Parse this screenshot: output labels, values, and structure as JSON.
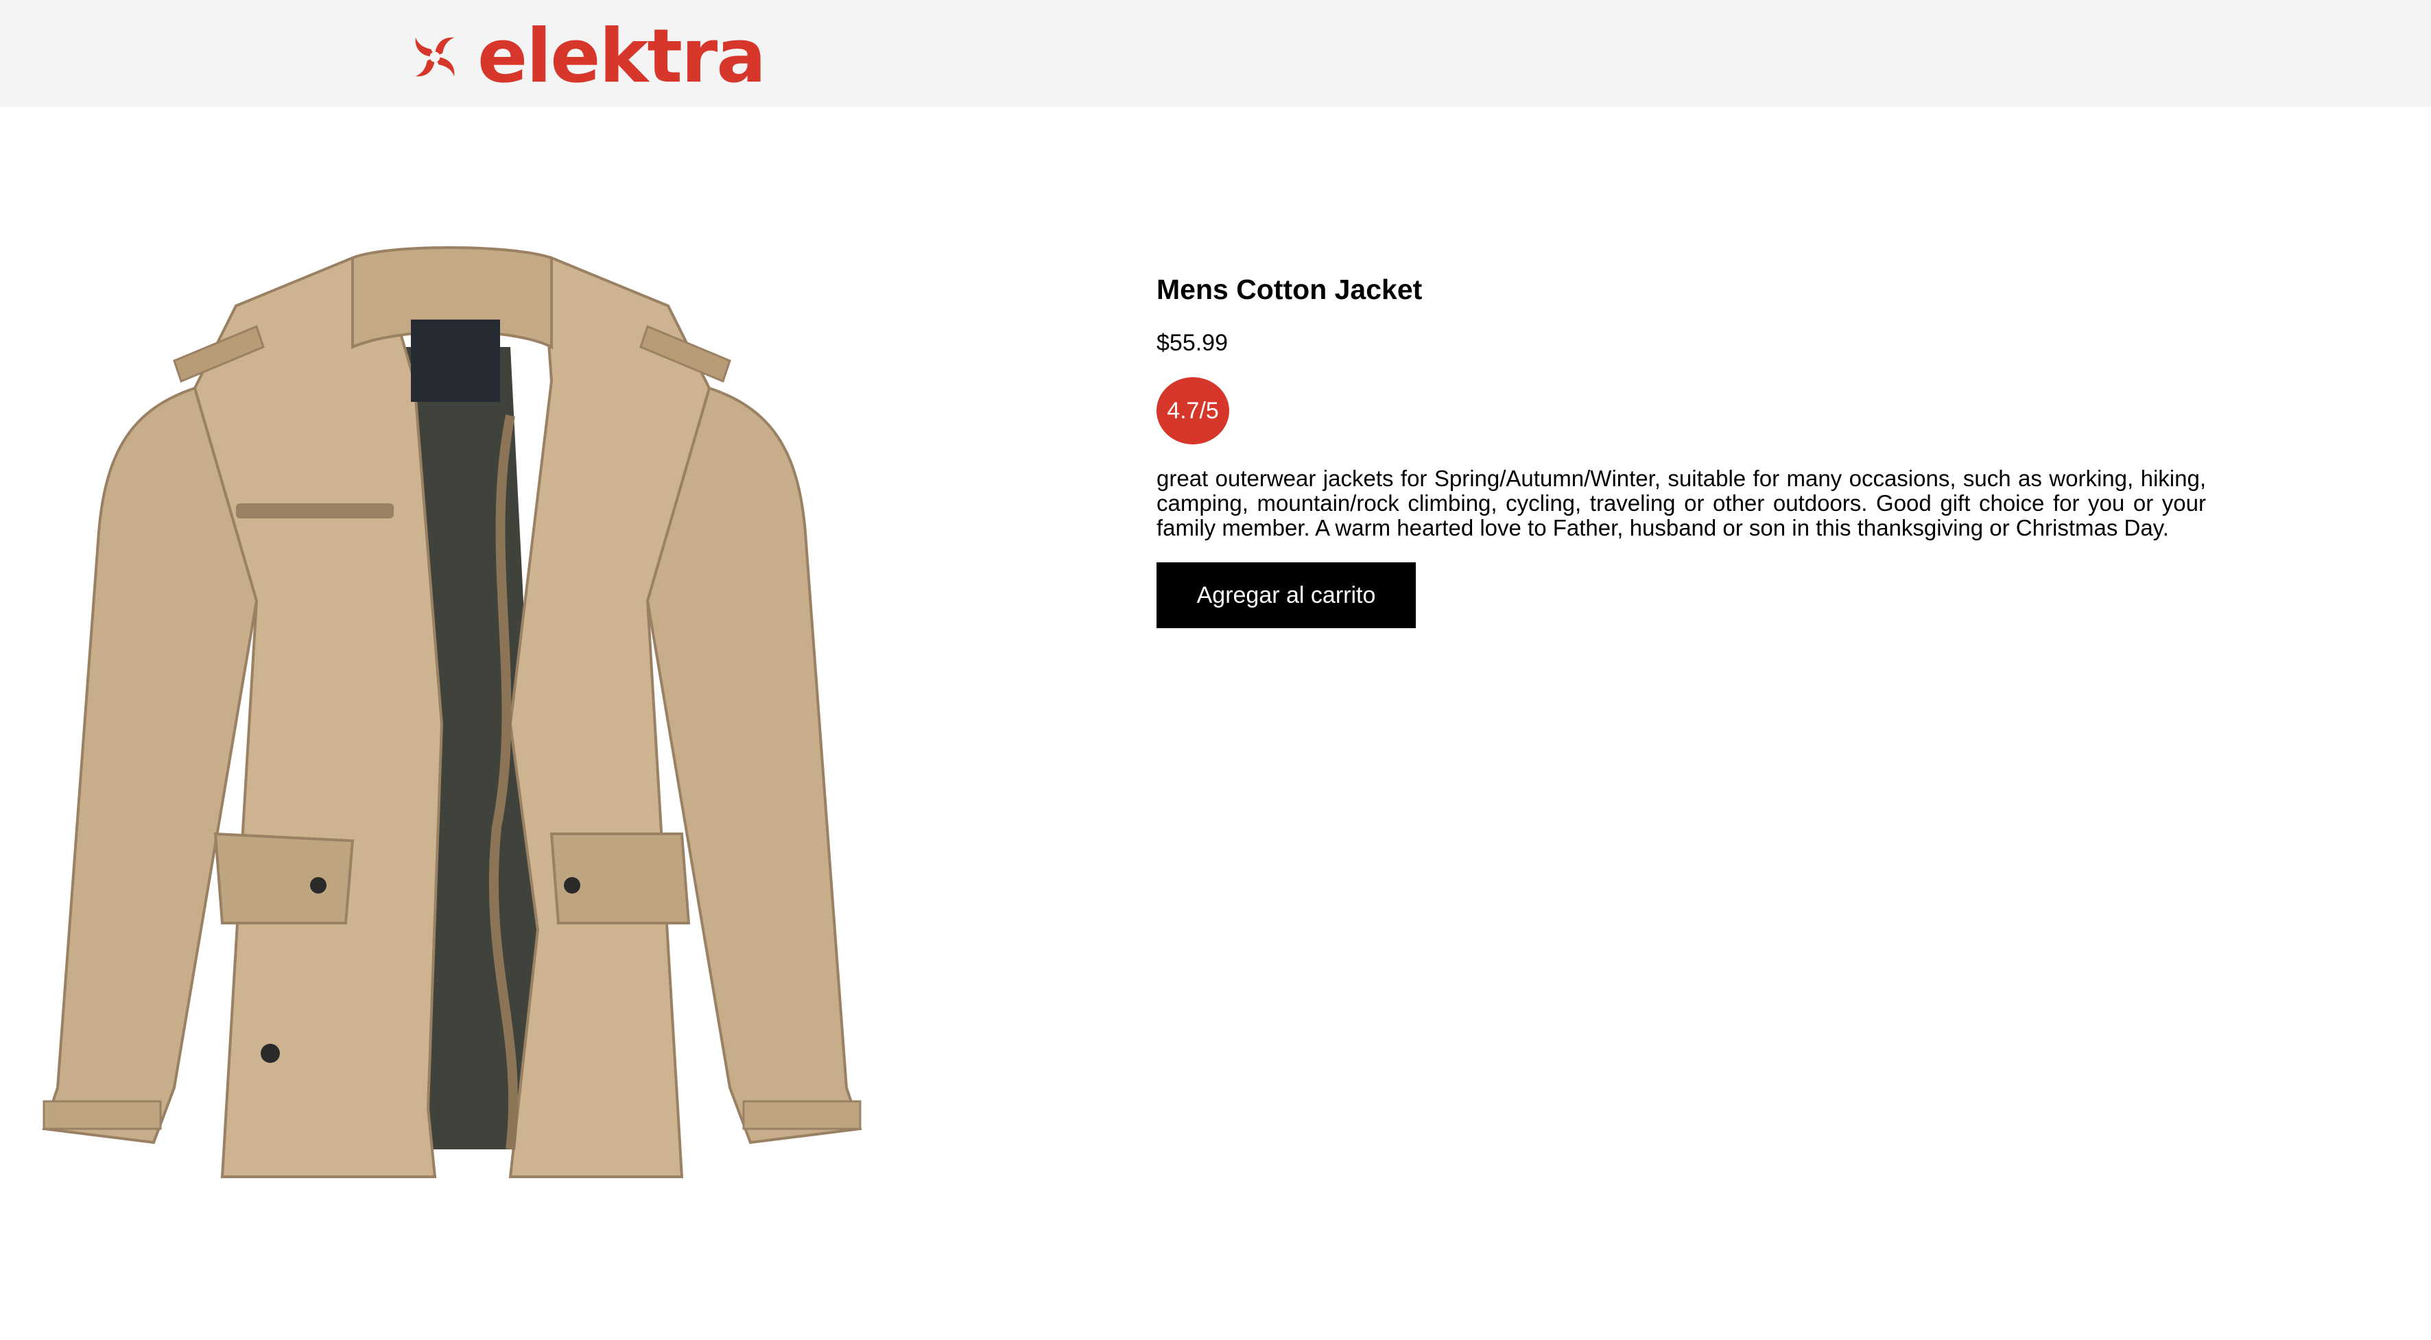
{
  "header": {
    "logo_text": "elektra",
    "logo_icon": "pinwheel-icon",
    "brand_color": "#d7372a",
    "background": "#f4f4f4"
  },
  "product": {
    "image_icon": "jacket-image",
    "title": "Mens Cotton Jacket",
    "price": "$55.99",
    "rating": "4.7/5",
    "rating_color": "#d7372a",
    "description": "great outerwear jackets for Spring/Autumn/Winter, suitable for many occasions, such as working, hiking, camping, mountain/rock climbing, cycling, traveling or other outdoors. Good gift choice for you or your family member. A warm hearted love to Father, husband or son in this thanksgiving or Christmas Day.",
    "add_to_cart_label": "Agregar al carrito"
  }
}
